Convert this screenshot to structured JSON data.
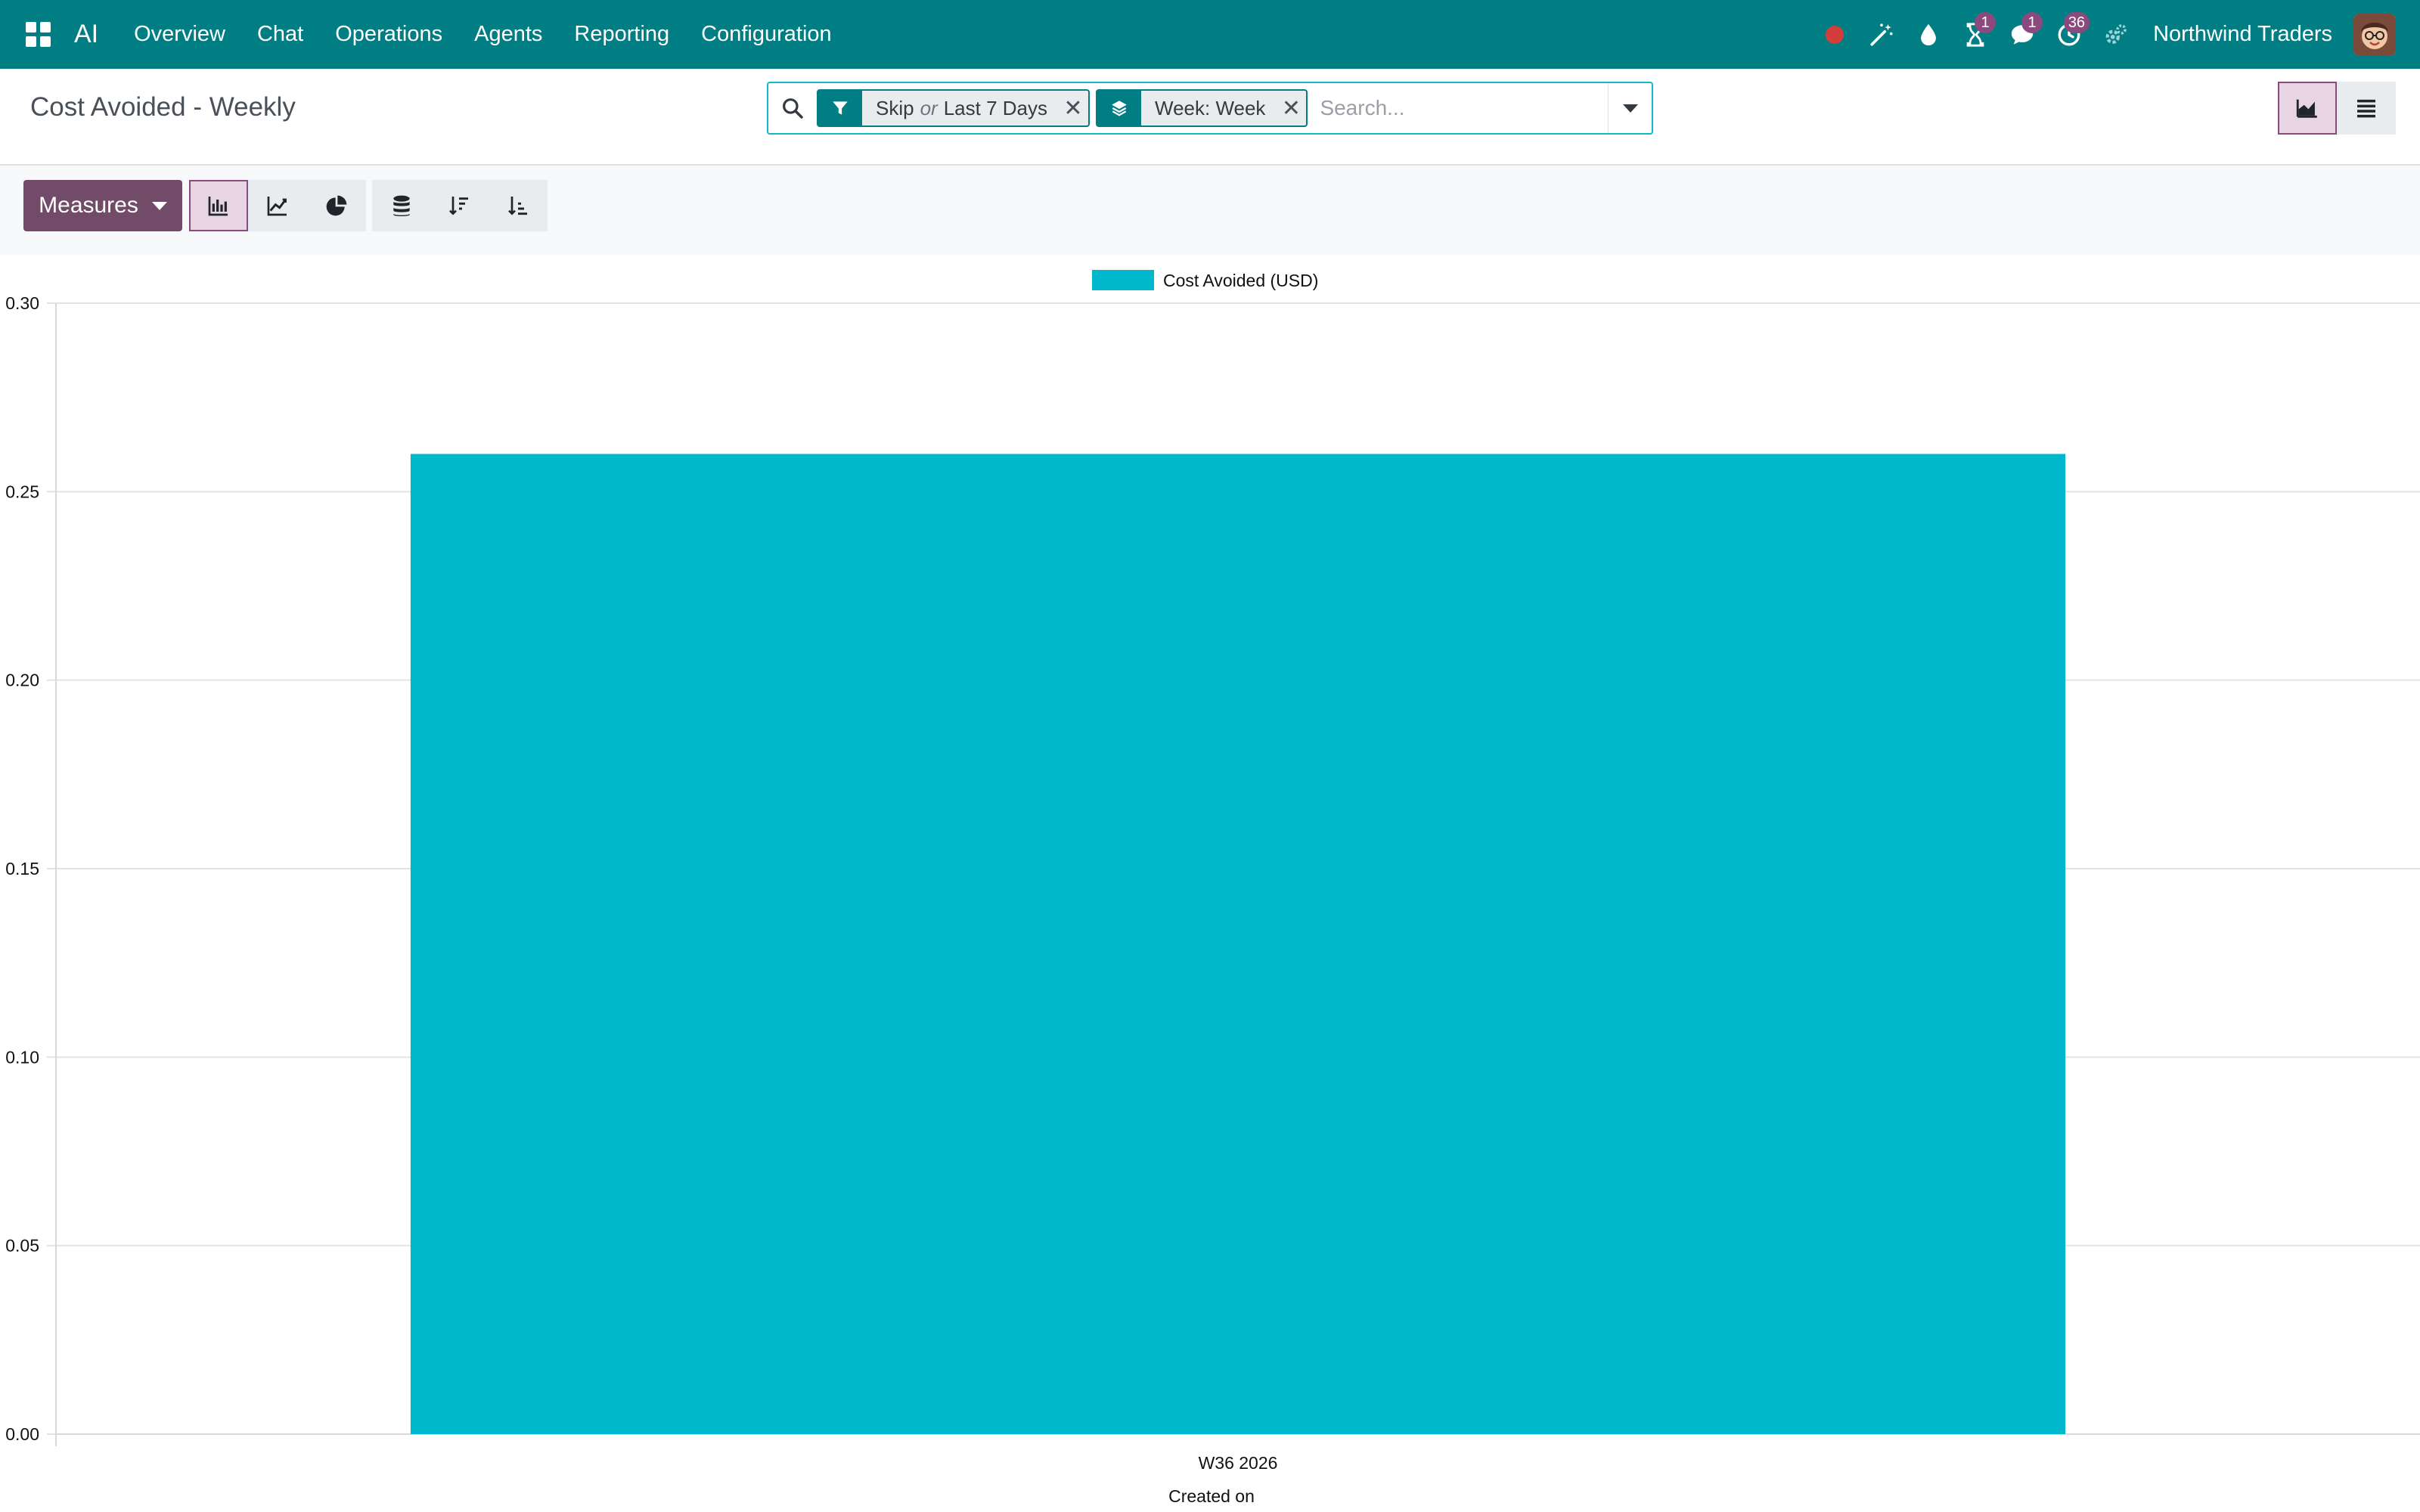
{
  "navbar": {
    "brand": "AI",
    "menu": [
      "Overview",
      "Chat",
      "Operations",
      "Agents",
      "Reporting",
      "Configuration"
    ],
    "system_icons": [
      {
        "icon": "record-dot-icon",
        "badge": ""
      },
      {
        "icon": "magic-wand-icon",
        "badge": ""
      },
      {
        "icon": "drop-icon",
        "badge": ""
      },
      {
        "icon": "hourglass-icon",
        "badge": "1"
      },
      {
        "icon": "chat-icon",
        "badge": "1"
      },
      {
        "icon": "activity-clock-icon",
        "badge": "36"
      },
      {
        "icon": "settings-gears-icon",
        "badge": ""
      }
    ],
    "company": "Northwind Traders"
  },
  "control_panel": {
    "title": "Cost Avoided - Weekly",
    "facets": {
      "filter": {
        "part1": "Skip",
        "separator": "or",
        "part2": "Last 7 Days"
      },
      "groupby": {
        "label": "Week: Week"
      }
    },
    "search_placeholder": "Search...",
    "views": [
      "graph-view",
      "list-view"
    ],
    "active_view": "graph-view"
  },
  "toolbar": {
    "measures_label": "Measures",
    "chart_modes": [
      "bar-chart",
      "line-chart",
      "pie-chart"
    ],
    "active_mode": "bar-chart",
    "options": [
      "stacked",
      "sort-descending",
      "sort-ascending"
    ]
  },
  "colors": {
    "navbar": "#017e84",
    "primary": "#714b67",
    "bar": "#00b8cc",
    "badge": "#8b4a7e"
  },
  "chart_data": {
    "type": "bar",
    "categories": [
      "W36 2026"
    ],
    "series": [
      {
        "name": "Cost Avoided (USD)",
        "values": [
          0.26
        ]
      }
    ],
    "xlabel": "Created on",
    "ylabel": "",
    "ylim": [
      0,
      0.3
    ],
    "yticks": [
      "0.00",
      "0.05",
      "0.10",
      "0.15",
      "0.20",
      "0.25",
      "0.30"
    ],
    "grid": true,
    "legend": "top-center"
  }
}
